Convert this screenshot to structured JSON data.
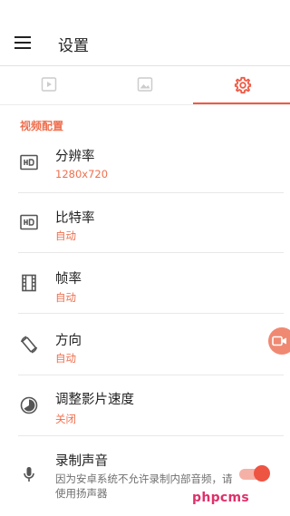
{
  "app": {
    "title": "设置"
  },
  "tabs": [
    {
      "icon": "video-icon",
      "active": false
    },
    {
      "icon": "image-icon",
      "active": false
    },
    {
      "icon": "gear-icon",
      "active": true
    }
  ],
  "colors": {
    "accent": "#ef5a45",
    "value_text": "#ef6f4e"
  },
  "section": {
    "header": "视频配置"
  },
  "items": [
    {
      "icon": "hd-icon",
      "label": "分辨率",
      "value": "1280x720"
    },
    {
      "icon": "hd-icon",
      "label": "比特率",
      "value": "自动"
    },
    {
      "icon": "film-icon",
      "label": "帧率",
      "value": "自动"
    },
    {
      "icon": "rotate-icon",
      "label": "方向",
      "value": "自动"
    },
    {
      "icon": "speed-icon",
      "label": "调整影片速度",
      "value": "关闭"
    },
    {
      "icon": "microphone-icon",
      "label": "录制声音",
      "description": "因为安卓系统不允许录制内部音频，请使用扬声器",
      "toggle_on": true
    }
  ],
  "watermark": "phpcms"
}
